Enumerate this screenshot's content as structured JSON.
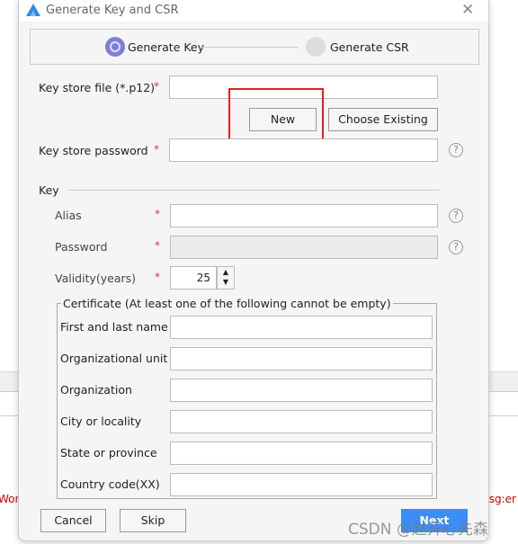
{
  "background": {
    "left_text": "Worl",
    "right_text": "msg:er"
  },
  "dialog": {
    "title": "Generate Key and CSR",
    "steps": [
      {
        "label": "Generate Key",
        "active": true
      },
      {
        "label": "Generate CSR",
        "active": false
      }
    ],
    "keystore_file": {
      "label": "Key store file (*.p12)",
      "value": ""
    },
    "new_label": "New",
    "choose_existing_label": "Choose Existing",
    "keystore_password": {
      "label": "Key store password",
      "value": ""
    },
    "key_section": "Key",
    "alias": {
      "label": "Alias",
      "value": ""
    },
    "password": {
      "label": "Password",
      "value": ""
    },
    "validity": {
      "label": "Validity(years)",
      "value": "25"
    },
    "certificate": {
      "legend": "Certificate (At least one of the following cannot be empty)",
      "fields": [
        {
          "label": "First and last name"
        },
        {
          "label": "Organizational unit"
        },
        {
          "label": "Organization"
        },
        {
          "label": "City or locality"
        },
        {
          "label": "State or province"
        },
        {
          "label": "Country code(XX)"
        }
      ]
    },
    "required_mark": "*",
    "help_mark": "?",
    "cancel_label": "Cancel",
    "skip_label": "Skip",
    "next_label": "Next"
  },
  "watermark": "CSDN @赵开心先森",
  "colors": {
    "accent": "#3a8ef6",
    "highlight": "#e02020",
    "step_active": "#7b7fd6"
  }
}
